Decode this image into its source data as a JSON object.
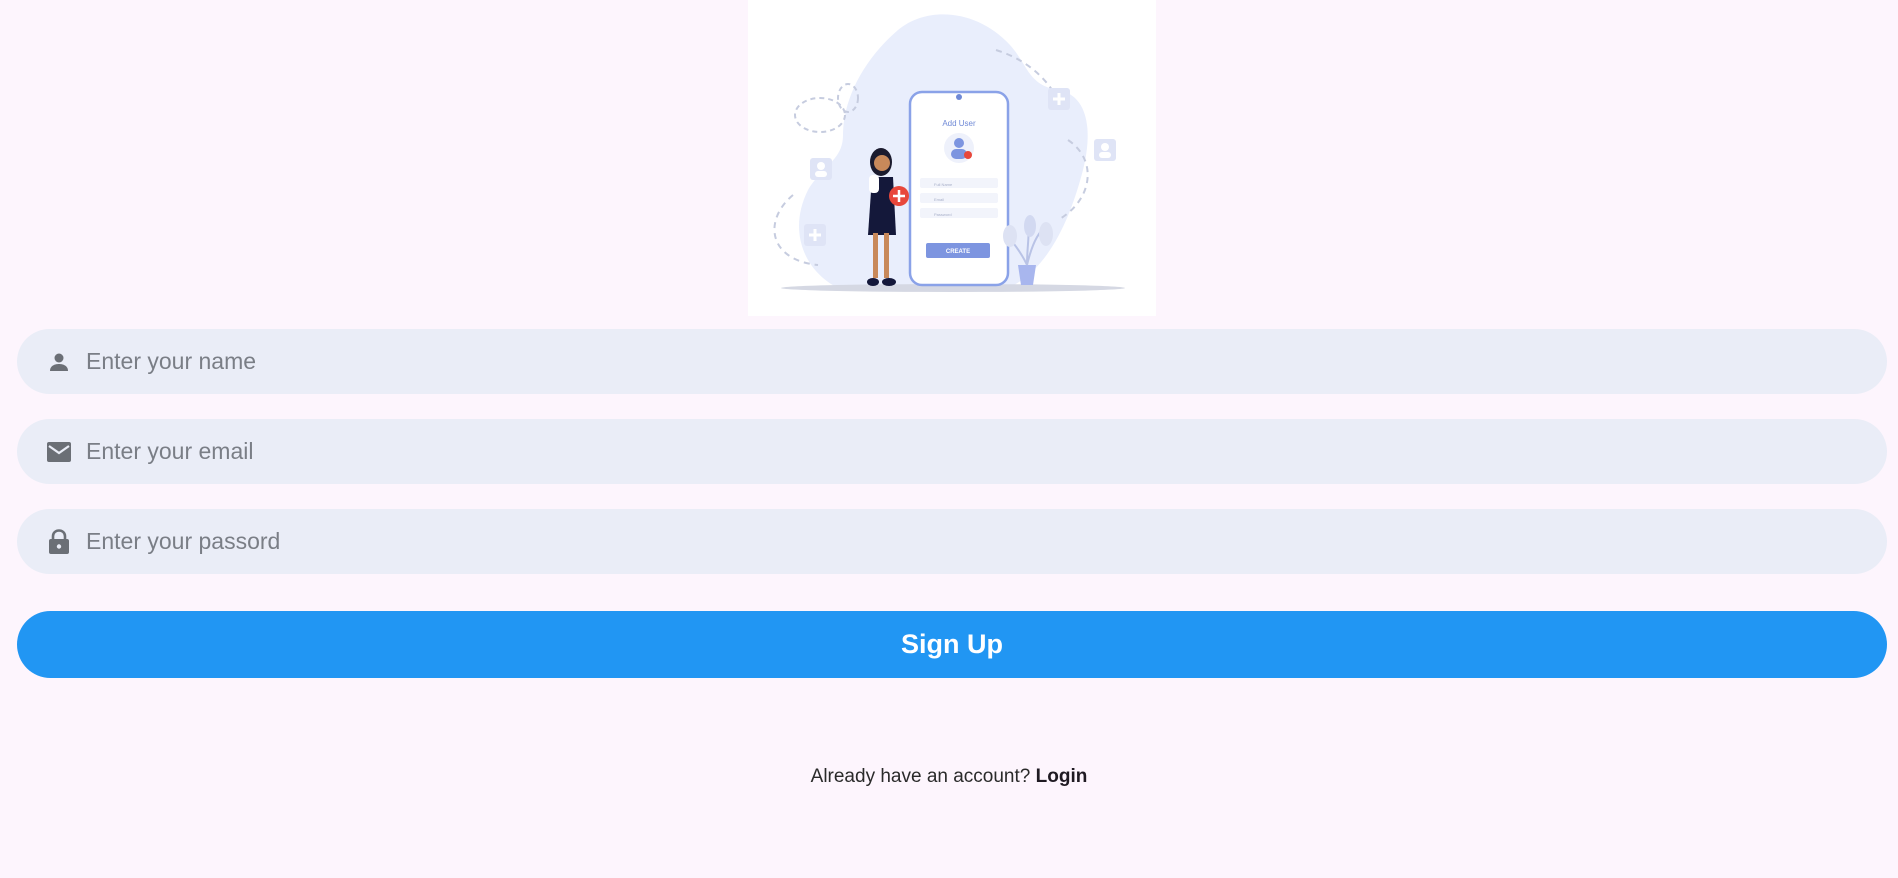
{
  "illustration": {
    "phone_title": "Add User",
    "phone_button": "CREATE",
    "phone_fields": [
      "Full Name",
      "Email",
      "Password"
    ]
  },
  "form": {
    "name_placeholder": "Enter your name",
    "email_placeholder": "Enter your email",
    "password_placeholder": "Enter your passord",
    "name_icon": "person-icon",
    "email_icon": "mail-icon",
    "password_icon": "lock-icon"
  },
  "signup_label": "Sign Up",
  "footer": {
    "prompt": "Already have an account? ",
    "login_label": "Login"
  },
  "colors": {
    "background": "#fdf5fd",
    "field_bg": "#eaedf7",
    "primary": "#2196f3"
  }
}
